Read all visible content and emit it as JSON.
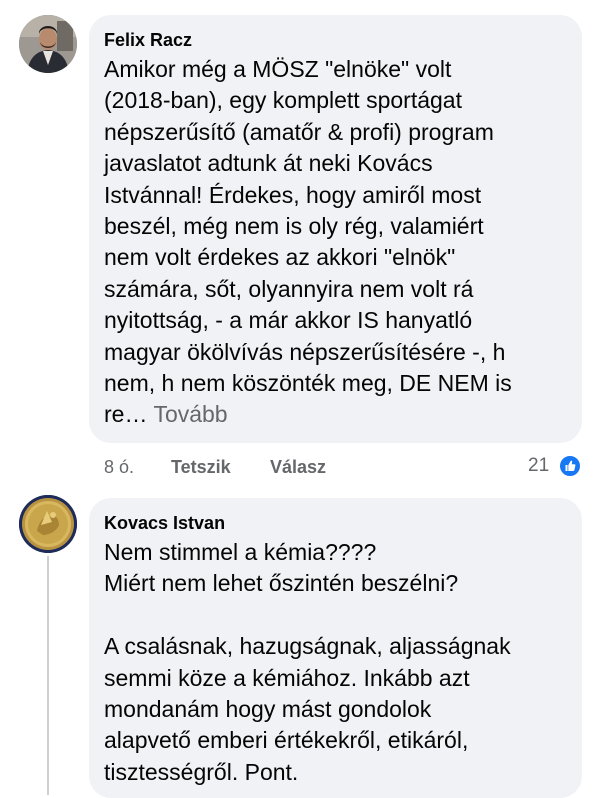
{
  "comments": [
    {
      "author": "Felix Racz",
      "lines": [
        "Amikor még a MÖSZ \"elnöke\" volt",
        "(2018-ban), egy komplett sportágat",
        "népszerűsítő (amatőr & profi) program",
        "javaslatot adtunk át neki Kovács",
        "Istvánnal! Érdekes, hogy amiről most",
        "beszél, még nem is oly rég, valamiért",
        "nem volt érdekes az akkori \"elnök\"",
        "számára, sőt, olyannyira nem volt rá",
        "nyitottság, - a már akkor IS hanyatló",
        "magyar ökölvívás népszerűsítésére -, h",
        "nem, h nem köszönték meg, DE NEM is"
      ],
      "truncated_tail": "re…",
      "more_label": "Tovább",
      "time": "8 ó.",
      "like_label": "Tetszik",
      "reply_label": "Válasz",
      "reaction_count": "21",
      "reaction_icon": "like-thumb-icon",
      "accent_color": "#1877f2"
    },
    {
      "author": "Kovacs Istvan",
      "lines": [
        "Nem stimmel a kémia????",
        "Miért nem lehet őszintén beszélni?",
        "",
        "A csalásnak, hazugságnak, aljasságnak",
        "semmi köze a kémiához. Inkább azt",
        "mondanám hogy mást gondolok",
        "alapvető emberi értékekről, etikáról,",
        "tisztességről. Pont."
      ]
    }
  ]
}
